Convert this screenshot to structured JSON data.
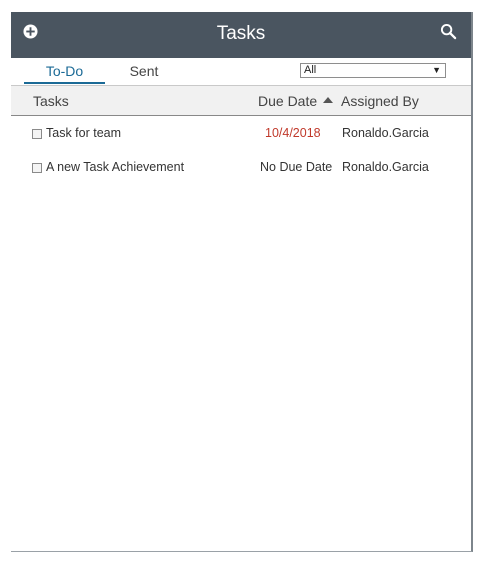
{
  "header": {
    "title": "Tasks",
    "add_icon": "plus-circle-icon",
    "search_icon": "search-icon",
    "background": "#4a5560"
  },
  "tabs": [
    {
      "label": "To-Do",
      "active": true
    },
    {
      "label": "Sent",
      "active": false
    }
  ],
  "filter": {
    "selected": "All"
  },
  "columns": {
    "tasks": "Tasks",
    "due_date": "Due Date",
    "assigned_by": "Assigned By",
    "sort": "due_date ascending"
  },
  "rows": [
    {
      "name": "Task for team",
      "due": "10/4/2018",
      "due_color": "#c0392b",
      "assigned_by": "Ronaldo.Garcia",
      "checked": false
    },
    {
      "name": "A new Task Achievement",
      "due": "No Due Date",
      "due_color": "#333333",
      "assigned_by": "Ronaldo.Garcia",
      "checked": false
    }
  ],
  "accent_color": "#1b6a96"
}
